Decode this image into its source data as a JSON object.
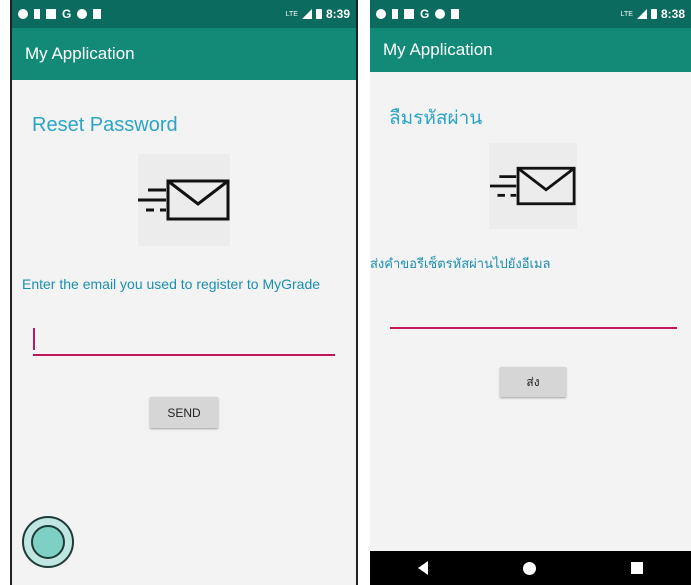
{
  "left": {
    "status": {
      "time": "8:39",
      "network": "LTE"
    },
    "app_title": "My Application",
    "page_title": "Reset Password",
    "prompt": "Enter the email you used to register to MyGrade",
    "email_value": "",
    "send_label": "SEND"
  },
  "right": {
    "status": {
      "time": "8:38",
      "network": "LTE"
    },
    "app_title": "My Application",
    "page_title": "ลืมรหัสผ่าน",
    "prompt": "ส่งคำขอรีเซ็ตรหัสผ่านไปยังอีเมล",
    "email_value": "",
    "send_label": "ส่ง"
  },
  "icons": {
    "status_left": [
      "notification-icon",
      "person-icon",
      "gallery-icon",
      "google-icon",
      "shield-icon",
      "sd-card-icon"
    ],
    "mail": "mail-send-icon",
    "fab": "assistive-touch-icon",
    "nav": [
      "back-icon",
      "home-icon",
      "recents-icon"
    ]
  },
  "colors": {
    "status_bar": "#0b6b5e",
    "app_bar": "#138a78",
    "title_text": "#2aa5c7",
    "field_underline": "#c2185b"
  }
}
